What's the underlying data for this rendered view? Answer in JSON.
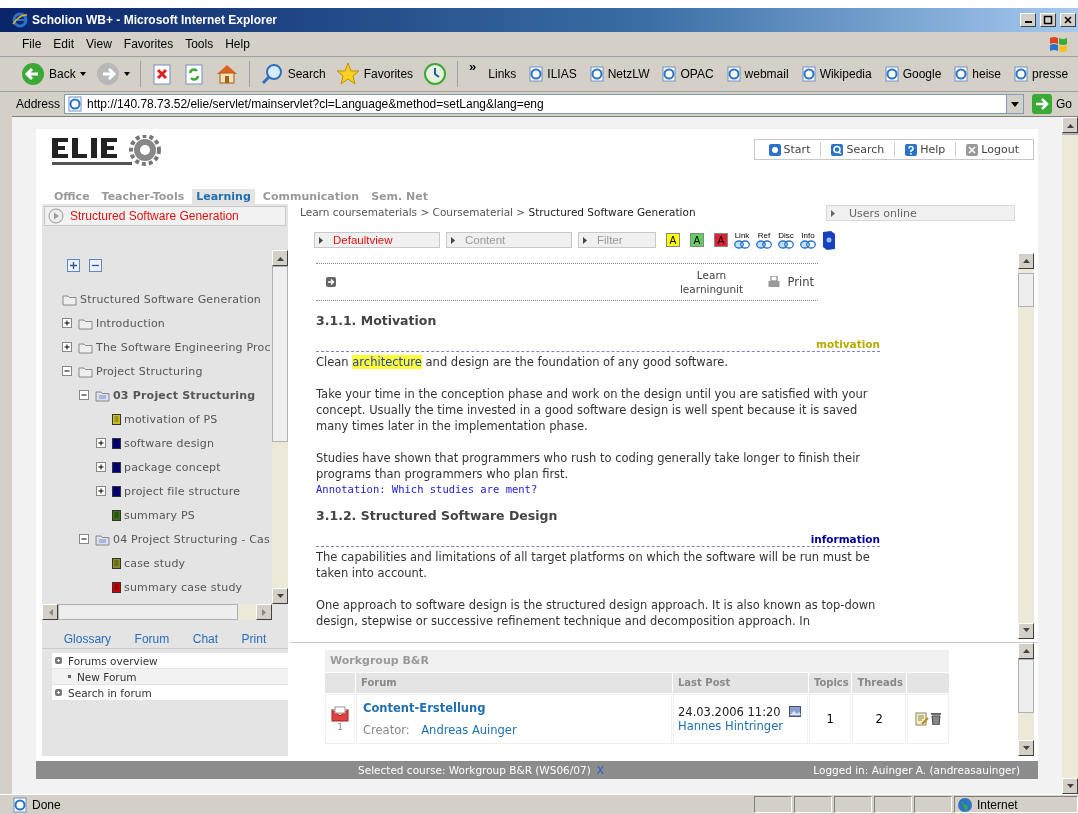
{
  "window": {
    "title": "Scholion WB+ - Microsoft Internet Explorer"
  },
  "menu": [
    "File",
    "Edit",
    "View",
    "Favorites",
    "Tools",
    "Help"
  ],
  "toolbar": {
    "buttons": [
      {
        "kind": "back",
        "label": "Back"
      },
      {
        "kind": "forward"
      },
      {
        "kind": "stop"
      },
      {
        "kind": "refresh"
      },
      {
        "kind": "home"
      },
      {
        "kind": "search",
        "label": "Search"
      },
      {
        "kind": "favorites",
        "label": "Favorites"
      },
      {
        "kind": "history"
      }
    ],
    "chevron": "»",
    "links_label": "Links",
    "links": [
      "ILIAS",
      "NetzLW",
      "OPAC",
      "webmail",
      "Wikipedia",
      "Google",
      "heise",
      "presse"
    ]
  },
  "address": {
    "label": "Address",
    "value": "http://140.78.73.52/elie/servlet/mainservlet?cl=Language&method=setLang&lang=eng",
    "go": "Go"
  },
  "app": {
    "header_buttons": [
      {
        "kind": "start",
        "label": "Start"
      },
      {
        "kind": "search",
        "label": "Search"
      },
      {
        "kind": "help",
        "label": "Help"
      },
      {
        "kind": "logout",
        "label": "Logout"
      }
    ],
    "tabs": [
      {
        "label": "Office",
        "selected": false
      },
      {
        "label": "Teacher-Tools",
        "selected": false
      },
      {
        "label": "Learning",
        "selected": true
      },
      {
        "label": "Communication",
        "selected": false
      },
      {
        "label": "Sem. Net",
        "selected": false
      }
    ],
    "course_title": "Structured Software Generation",
    "breadcrumb": "Learn coursematerials > Coursematerial > **Structured Software Generation**",
    "users_online": "Users online",
    "views": [
      {
        "label": "Defaultview",
        "selected": true
      },
      {
        "label": "Content",
        "selected": false
      },
      {
        "label": "Filter",
        "selected": false
      }
    ],
    "annotation_filters": [
      {
        "label": "A",
        "color": "#ffff00"
      },
      {
        "label": "A",
        "color": "#66cc66"
      },
      {
        "label": "A",
        "color": "#dd2233"
      }
    ],
    "link_toggles": [
      "Link",
      "Ref",
      "Disc",
      "Info"
    ],
    "tree": {
      "root": "Structured Software Generation",
      "items": [
        {
          "label": "Introduction",
          "kind": "folder",
          "expanded": false,
          "selected": false
        },
        {
          "label": "The Software Engineering Proc",
          "kind": "folder",
          "expanded": false,
          "selected": false
        },
        {
          "label": "Project Structuring",
          "kind": "folder",
          "expanded": true,
          "selected": false,
          "children": [
            {
              "label": "03 Project Structuring",
              "kind": "unit",
              "expanded": true,
              "selected": true,
              "children": [
                {
                  "label": "motivation of PS",
                  "kind": "page",
                  "selected": false,
                  "color": "#c8c020"
                },
                {
                  "label": "software design",
                  "kind": "page",
                  "expanded": false,
                  "selected": false,
                  "color": "#000080"
                },
                {
                  "label": "package concept",
                  "kind": "page",
                  "expanded": false,
                  "selected": false,
                  "color": "#000080"
                },
                {
                  "label": "project file structure",
                  "kind": "page",
                  "expanded": false,
                  "selected": false,
                  "color": "#000080"
                },
                {
                  "label": "summary PS",
                  "kind": "page",
                  "selected": false,
                  "color": "#3c6e14"
                }
              ]
            },
            {
              "label": "04 Project Structuring - Cas",
              "kind": "unit",
              "expanded": true,
              "selected": false,
              "children": [
                {
                  "label": "case study",
                  "kind": "page",
                  "selected": false,
                  "color": "#8a8a20"
                },
                {
                  "label": "summary case study",
                  "kind": "page",
                  "selected": false,
                  "color": "#cc0000"
                }
              ]
            }
          ]
        }
      ]
    },
    "sidebar_links": [
      "Glossary",
      "Forum",
      "Chat",
      "Print"
    ],
    "forum_menu": [
      {
        "kind": "main",
        "label": "Forums overview"
      },
      {
        "kind": "sub",
        "label": "New Forum"
      },
      {
        "kind": "main",
        "label": "Search in forum"
      }
    ],
    "content": {
      "learn": "Learn learningunit",
      "print": "Print",
      "sections": [
        {
          "heading": "3.1.1. Motivation",
          "tag": "motivation",
          "color": "#b8a800",
          "blocks": [
            {
              "kind": "paragraph",
              "runs": [
                {
                  "text": "Clean ",
                  "highlighted": false
                },
                {
                  "text": "architecture",
                  "highlighted": true
                },
                {
                  "text": " and design are the foundation of any good software.",
                  "highlighted": false
                }
              ]
            },
            {
              "kind": "paragraph",
              "runs": [
                {
                  "text": "Take your time in the conception phase and work on the design until you are satisfied with your concept. Usually the time invested in a good software design is well spent because it is saved many times later in the implementation phase.",
                  "highlighted": false
                }
              ]
            },
            {
              "kind": "paragraph",
              "runs": [
                {
                  "text": "Studies have shown that programmers who rush to coding generally take longer to finish their programs than programmers who plan first.",
                  "highlighted": false
                }
              ]
            },
            {
              "kind": "annotation",
              "text": "Annotation: Which studies are ment?"
            }
          ]
        },
        {
          "heading": "3.1.2. Structured Software Design",
          "tag": "information",
          "color": "#000099",
          "blocks": [
            {
              "kind": "paragraph",
              "runs": [
                {
                  "text": "The capabilities and limitations of all target platforms on which the software will be run must be taken into account.",
                  "highlighted": false
                }
              ]
            },
            {
              "kind": "paragraph",
              "runs": [
                {
                  "text": "One approach to software design is the structured design approach. It is also known as top-down design, stepwise or successive refinement technique and decomposition approach. In",
                  "highlighted": false
                }
              ]
            }
          ]
        }
      ]
    },
    "forum": {
      "title": "Workgroup B&R",
      "columns": [
        "Forum",
        "Last Post",
        "Topics",
        "Threads"
      ],
      "rows": [
        {
          "count": "1",
          "name": "Content-Erstellung",
          "creator_label": "Creator:",
          "creator": "Andreas Auinger",
          "last_post_date": "24.03.2006 11:20",
          "last_post_author": "Hannes Hintringer",
          "topics": "1",
          "threads": "2"
        }
      ]
    },
    "footer": {
      "selected_course": "Selected course: Workgroup B&R (WS06/07)",
      "clear": "X",
      "logged_in": "Logged in: Auinger A. (andreasauinger)"
    }
  },
  "status_bar": {
    "text": "Done",
    "zone": "Internet"
  }
}
